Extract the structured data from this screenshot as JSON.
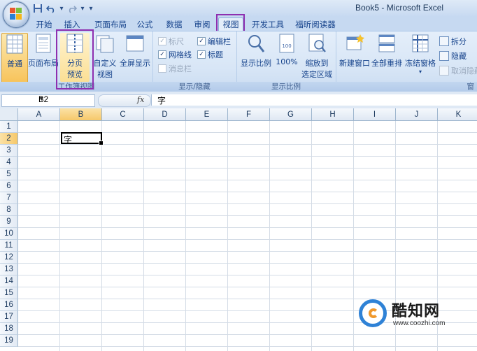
{
  "window": {
    "title": "Book5 - Microsoft Excel"
  },
  "quick_access": {
    "icons": [
      "save-icon",
      "undo-icon",
      "redo-icon",
      "customize-icon"
    ]
  },
  "tabs": [
    {
      "label": "开始"
    },
    {
      "label": "插入"
    },
    {
      "label": "页面布局"
    },
    {
      "label": "公式"
    },
    {
      "label": "数据"
    },
    {
      "label": "审阅"
    },
    {
      "label": "视图",
      "active": true
    },
    {
      "label": "开发工具"
    },
    {
      "label": "福昕阅读器"
    }
  ],
  "ribbon": {
    "workbook_views": {
      "label": "工作簿视图",
      "normal": "普通",
      "page_layout": "页面布局",
      "page_break_line1": "分页",
      "page_break_line2": "预览",
      "custom_line1": "自定义",
      "custom_line2": "视图",
      "fullscreen": "全屏显示"
    },
    "show_hide": {
      "label": "显示/隐藏",
      "ruler": "标尺",
      "formula_bar": "编辑栏",
      "gridlines": "网格线",
      "headings": "标题",
      "message_bar": "消息栏"
    },
    "zoom": {
      "label": "显示比例",
      "zoom": "显示比例",
      "hundred": "100%",
      "selection_line1": "缩放到",
      "selection_line2": "选定区域"
    },
    "window": {
      "label": "窗",
      "new_window": "新建窗口",
      "arrange_all": "全部重排",
      "freeze_panes": "冻结窗格",
      "split": "拆分",
      "hide": "隐藏",
      "unhide": "取消隐藏"
    }
  },
  "formula_bar": {
    "name_box": "B2",
    "fx": "fx",
    "content": "字"
  },
  "sheet": {
    "columns": [
      "A",
      "B",
      "C",
      "D",
      "E",
      "F",
      "G",
      "H",
      "I",
      "J",
      "K"
    ],
    "rows": [
      "1",
      "2",
      "3",
      "4",
      "5",
      "6",
      "7",
      "8",
      "9",
      "10",
      "11",
      "12",
      "13",
      "14",
      "15",
      "16",
      "17",
      "18",
      "19"
    ],
    "selected_column": "B",
    "selected_row": "2",
    "active_cell_text": "字"
  },
  "watermark": {
    "name": "酷知网",
    "url": "www.coozhi.com"
  },
  "colors": {
    "highlight": "#8e2fb0",
    "selection": "#f6c86a"
  }
}
